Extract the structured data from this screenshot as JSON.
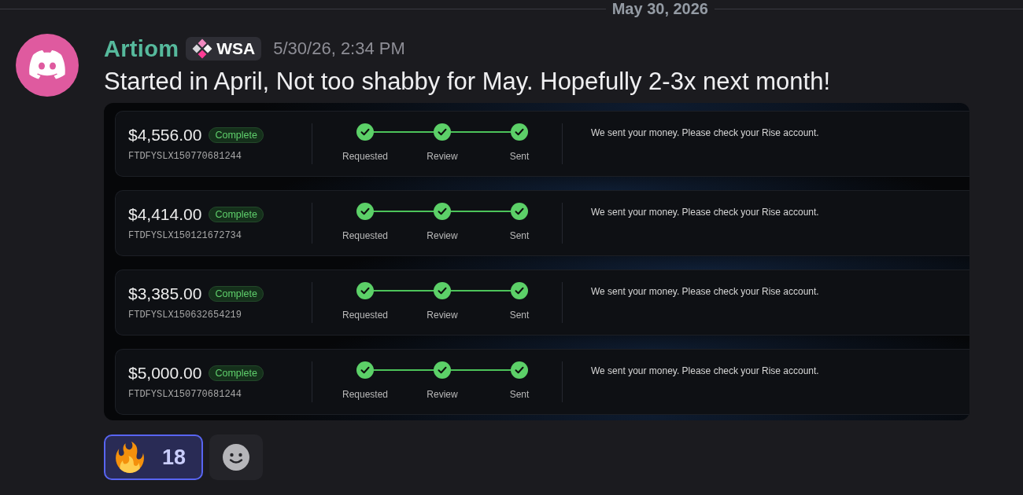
{
  "date_divider": {
    "label": "May 30, 2026"
  },
  "message": {
    "author": "Artiom",
    "tag": "WSA",
    "timestamp": "5/30/26, 2:34 PM",
    "text": "Started in April, Not too shabby for May. Hopefully 2-3x next month!"
  },
  "attachment": {
    "payouts": [
      {
        "amount": "$4,556.00",
        "status": "Complete",
        "reference": "FTDFYSLX150770681244",
        "steps": [
          {
            "label": "Requested",
            "done": true
          },
          {
            "label": "Review",
            "done": true
          },
          {
            "label": "Sent",
            "done": true
          }
        ],
        "note": "We sent your money. Please check your Rise account."
      },
      {
        "amount": "$4,414.00",
        "status": "Complete",
        "reference": "FTDFYSLX150121672734",
        "steps": [
          {
            "label": "Requested",
            "done": true
          },
          {
            "label": "Review",
            "done": true
          },
          {
            "label": "Sent",
            "done": true
          }
        ],
        "note": "We sent your money. Please check your Rise account."
      },
      {
        "amount": "$3,385.00",
        "status": "Complete",
        "reference": "FTDFYSLX150632654219",
        "steps": [
          {
            "label": "Requested",
            "done": true
          },
          {
            "label": "Review",
            "done": true
          },
          {
            "label": "Sent",
            "done": true
          }
        ],
        "note": "We sent your money. Please check your Rise account."
      },
      {
        "amount": "$5,000.00",
        "status": "Complete",
        "reference": "FTDFYSLX150770681244",
        "steps": [
          {
            "label": "Requested",
            "done": true
          },
          {
            "label": "Review",
            "done": true
          },
          {
            "label": "Sent",
            "done": true
          }
        ],
        "note": "We sent your money. Please check your Rise account."
      }
    ]
  },
  "reactions": [
    {
      "count": "18",
      "selected": true
    }
  ]
}
